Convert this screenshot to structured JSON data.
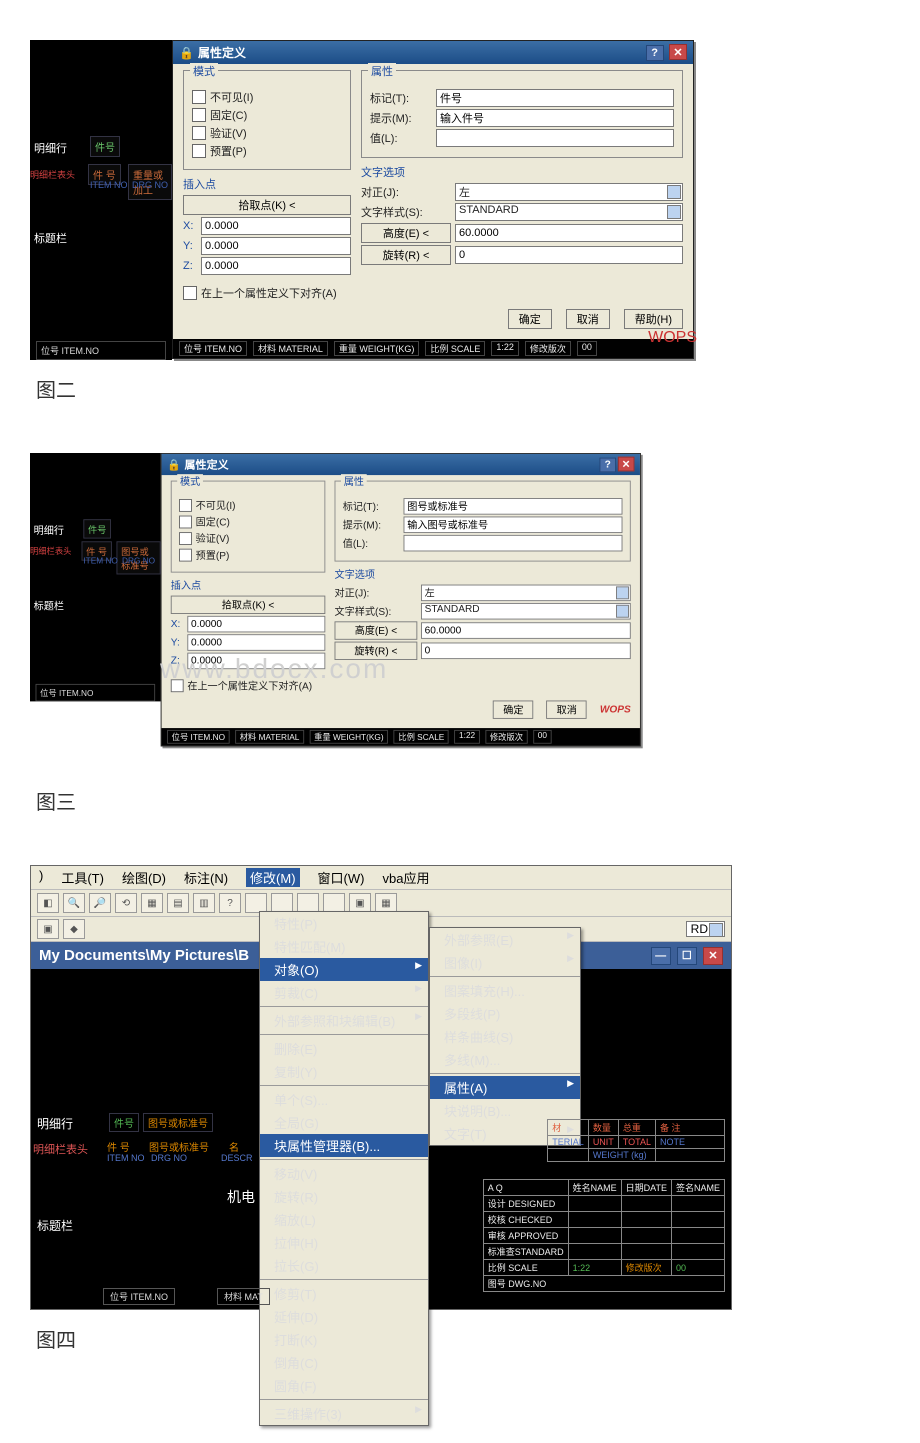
{
  "fig1": {
    "sidepanel": {
      "label_detail": "明细行",
      "label_titlebar": "标题栏",
      "cell1": "件号",
      "red1": "明细栏表头",
      "cell2": "件 号",
      "cell3": "重量或加工",
      "sub1": "ITEM NO",
      "sub2": "DRG NO",
      "bottom": "位号 ITEM.NO"
    },
    "dialog": {
      "title": "属性定义",
      "mode_legend": "模式",
      "mode_items": [
        "不可见(I)",
        "固定(C)",
        "验证(V)",
        "预置(P)"
      ],
      "attr_legend": "属性",
      "attr_tag_lbl": "标记(T):",
      "attr_tag_val": "件号",
      "attr_prompt_lbl": "提示(M):",
      "attr_prompt_val": "输入件号",
      "attr_value_lbl": "值(L):",
      "attr_value_val": "",
      "ins_legend": "插入点",
      "pick_btn": "拾取点(K) <",
      "x": "0.0000",
      "y": "0.0000",
      "z": "0.0000",
      "textopt_legend": "文字选项",
      "justify_lbl": "对正(J):",
      "justify_val": "左",
      "style_lbl": "文字样式(S):",
      "style_val": "STANDARD",
      "height_btn": "高度(E) <",
      "height_val": "60.0000",
      "rot_btn": "旋转(R) <",
      "rot_val": "0",
      "align_chk": "在上一个属性定义下对齐(A)",
      "ok": "确定",
      "cancel": "取消",
      "help": "帮助(H)"
    },
    "status": [
      "位号 ITEM.NO",
      "材料 MATERIAL",
      "重量 WEIGHT(KG)",
      "比例 SCALE",
      "1:22",
      "修改版次",
      "00"
    ],
    "caption": "图二"
  },
  "fig2": {
    "dialog": {
      "attr_tag_val": "图号或标准号",
      "attr_prompt_val": "输入图号或标准号"
    },
    "sidepanel": {
      "cell2": "件 号",
      "cell3": "图号或标准号",
      "sub2": "DRG NO"
    },
    "watermark": "www.bdocx.com",
    "caption": "图三"
  },
  "fig3": {
    "menubar": [
      "工具(T)",
      "绘图(D)",
      "标注(N)",
      "修改(M)",
      "窗口(W)",
      "vba应用"
    ],
    "toolbar_icons": [
      "◧",
      "🔍",
      "🔎",
      "⟲",
      "▦",
      "▤",
      "▥",
      "?",
      "",
      "",
      "",
      "",
      "▣",
      "▦"
    ],
    "rd_label": "RD",
    "path": "My Documents\\My Pictures\\B",
    "modify_menu": {
      "items": [
        {
          "t": "特性(P)"
        },
        {
          "t": "特性匹配(M)"
        },
        {
          "t": "对象(O)",
          "arrow": true,
          "hl": true
        },
        {
          "t": "剪裁(C)",
          "arrow": true
        },
        {
          "sep": true
        },
        {
          "t": "外部参照和块编辑(B)",
          "arrow": true
        },
        {
          "sep": true
        },
        {
          "t": "删除(E)"
        },
        {
          "t": "复制(Y)"
        },
        {
          "sep": true
        },
        {
          "t": "单个(S)..."
        },
        {
          "t": "全局(G)"
        },
        {
          "t": "块属性管理器(B)...",
          "hl": true
        },
        {
          "sep": true
        },
        {
          "t": "移动(V)"
        },
        {
          "t": "旋转(R)"
        },
        {
          "t": "缩放(L)"
        },
        {
          "t": "拉伸(H)"
        },
        {
          "t": "拉长(G)"
        },
        {
          "sep": true
        },
        {
          "t": "修剪(T)"
        },
        {
          "t": "延伸(D)"
        },
        {
          "t": "打断(K)"
        },
        {
          "t": "倒角(C)"
        },
        {
          "t": "圆角(F)"
        },
        {
          "sep": true
        },
        {
          "t": "三维操作(3)",
          "arrow": true
        }
      ]
    },
    "object_submenu": [
      {
        "t": "外部参照(E)",
        "arrow": true
      },
      {
        "t": "图像(I)",
        "arrow": true
      },
      {
        "sep": true
      },
      {
        "t": "图案填充(H)..."
      },
      {
        "t": "多段线(P)"
      },
      {
        "t": "样条曲线(S)"
      },
      {
        "t": "多线(M)..."
      },
      {
        "sep": true
      },
      {
        "t": "属性(A)",
        "arrow": true,
        "hl": true
      },
      {
        "t": "块说明(B)..."
      },
      {
        "t": "文字(T)",
        "arrow": true
      }
    ],
    "left_labels": {
      "detail": "明细行",
      "header": "明细栏表头",
      "title": "标题栏",
      "c1": "件号",
      "c2": "图号或标准号",
      "r2a": "件 号",
      "r2b": "图号或标准号",
      "r2c": "名",
      "s1": "ITEM NO",
      "s2": "DRG NO",
      "s3": "DESCR",
      "mech": "机电",
      "bottom_item": "位号 ITEM.NO",
      "bottom_mat": "材料 MAT"
    },
    "title_block": {
      "top_row": [
        "材",
        "数量",
        "总重",
        "备 注"
      ],
      "sub_row": [
        "TERIAL",
        "UNIT",
        "TOTAL",
        "NOTE"
      ],
      "sub_row2": [
        "",
        "WEIGHT (kg)",
        ""
      ],
      "hdr": [
        "A Q",
        "姓名NAME",
        "日期DATE",
        "签名NAME"
      ],
      "rows": [
        "设计 DESIGNED",
        "校核 CHECKED",
        "审核 APPROVED",
        "标准查STANDARD"
      ],
      "scale_row": [
        "比例 SCALE",
        "1:22",
        "修改版次",
        "00"
      ],
      "dwg": "图号 DWG.NO"
    },
    "caption": "图四"
  }
}
